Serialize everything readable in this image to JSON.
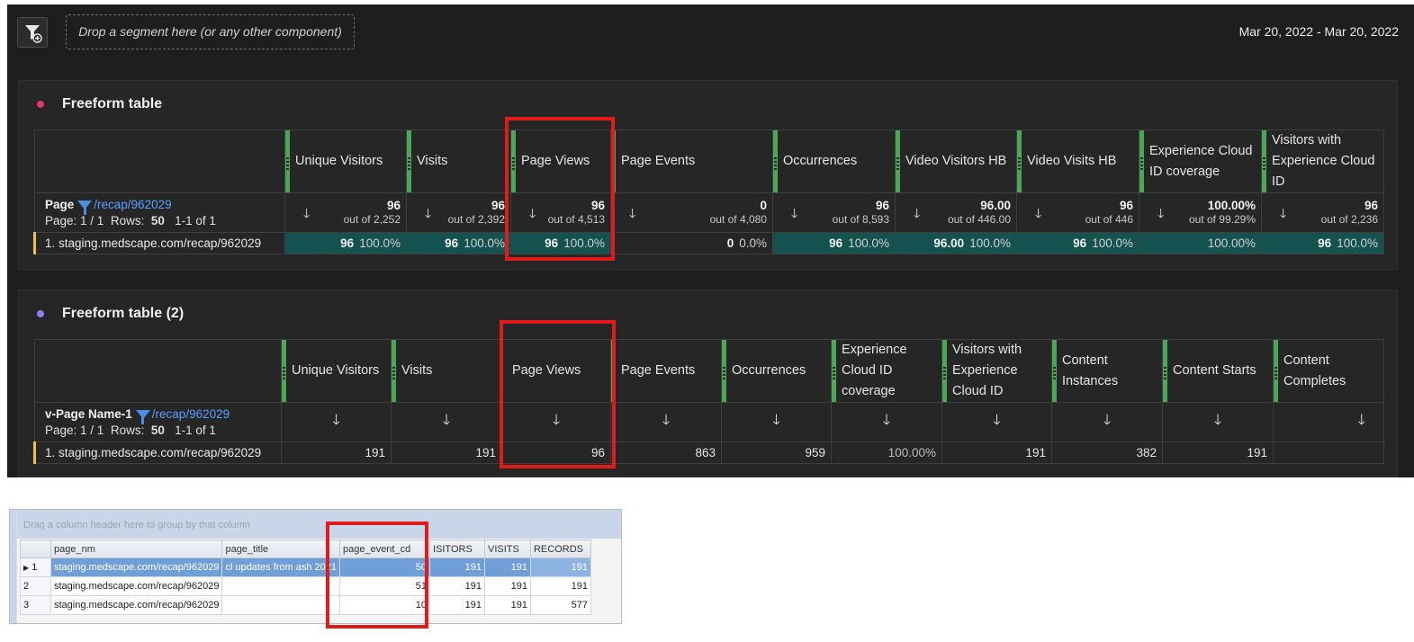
{
  "topbar": {
    "segment_placeholder": "Drop a segment here (or any other component)",
    "date_range": "Mar 20, 2022 - Mar 20, 2022",
    "filter_icon": "filter-add-icon"
  },
  "colors": {
    "panel1_dot": "#e0337d",
    "panel2_dot": "#8c7cf5",
    "metric_bar": "#4aa857",
    "highlight": "#e01b1b",
    "cell_fill": "#13524e"
  },
  "panel1": {
    "title": "Freeform table",
    "dimension": {
      "name": "Page",
      "filter": "/recap/962029",
      "page_label": "Page: 1 / 1",
      "rows_label": "Rows:",
      "rows_value": "50",
      "range": "1-1 of 1"
    },
    "columns": [
      {
        "label": "Unique Visitors",
        "total": "96",
        "out_of": "out of 2,252"
      },
      {
        "label": "Visits",
        "total": "96",
        "out_of": "out of 2,392"
      },
      {
        "label": "Page Views",
        "total": "96",
        "out_of": "out of 4,513"
      },
      {
        "label": "Page Events",
        "total": "0",
        "out_of": "out of 4,080"
      },
      {
        "label": "Occurrences",
        "total": "96",
        "out_of": "out of 8,593"
      },
      {
        "label": "Video Visitors HB",
        "total": "96.00",
        "out_of": "out of 446.00"
      },
      {
        "label": "Video Visits HB",
        "total": "96",
        "out_of": "out of 446"
      },
      {
        "label": "Experience Cloud ID coverage",
        "total": "100.00%",
        "out_of": "out of 99.29%"
      },
      {
        "label": "Visitors with Experience Cloud ID",
        "total": "96",
        "out_of": "out of 2,236"
      }
    ],
    "row": {
      "label": "1.  staging.medscape.com/recap/962029",
      "cells": [
        {
          "value": "96",
          "pct": "100.0%"
        },
        {
          "value": "96",
          "pct": "100.0%"
        },
        {
          "value": "96",
          "pct": "100.0%"
        },
        {
          "value": "0",
          "pct": "0.0%"
        },
        {
          "value": "96",
          "pct": "100.0%"
        },
        {
          "value": "96.00",
          "pct": "100.0%"
        },
        {
          "value": "96",
          "pct": "100.0%"
        },
        {
          "value": "",
          "pct": "100.00%"
        },
        {
          "value": "96",
          "pct": "100.0%"
        }
      ]
    }
  },
  "panel2": {
    "title": "Freeform table (2)",
    "dimension": {
      "name": "v-Page Name-1",
      "filter": "/recap/962029",
      "page_label": "Page: 1 / 1",
      "rows_label": "Rows:",
      "rows_value": "50",
      "range": "1-1 of 1"
    },
    "columns": [
      {
        "label": "Unique Visitors"
      },
      {
        "label": "Visits"
      },
      {
        "label": "Page Views"
      },
      {
        "label": "Page Events"
      },
      {
        "label": "Occurrences"
      },
      {
        "label": "Experience Cloud ID coverage"
      },
      {
        "label": "Visitors with Experience Cloud ID"
      },
      {
        "label": "Content Instances"
      },
      {
        "label": "Content Starts"
      },
      {
        "label": "Content Completes"
      }
    ],
    "row": {
      "label": "1.  staging.medscape.com/recap/962029",
      "cells": [
        "191",
        "191",
        "96",
        "863",
        "959",
        "100.00%",
        "191",
        "382",
        "191",
        ""
      ]
    }
  },
  "grid": {
    "group_hint": "Drag a column header here to group by that column",
    "headers": [
      "page_nm",
      "page_title",
      "page_event_cd",
      "ISITORS",
      "VISITS",
      "RECORDS"
    ],
    "rows": [
      [
        "1",
        "staging.medscape.com/recap/962029",
        "cl updates from ash 2021",
        "50",
        "191",
        "191",
        "191"
      ],
      [
        "2",
        "staging.medscape.com/recap/962029",
        "",
        "51",
        "191",
        "191",
        "191"
      ],
      [
        "3",
        "staging.medscape.com/recap/962029",
        "",
        "10",
        "191",
        "191",
        "577"
      ]
    ]
  }
}
